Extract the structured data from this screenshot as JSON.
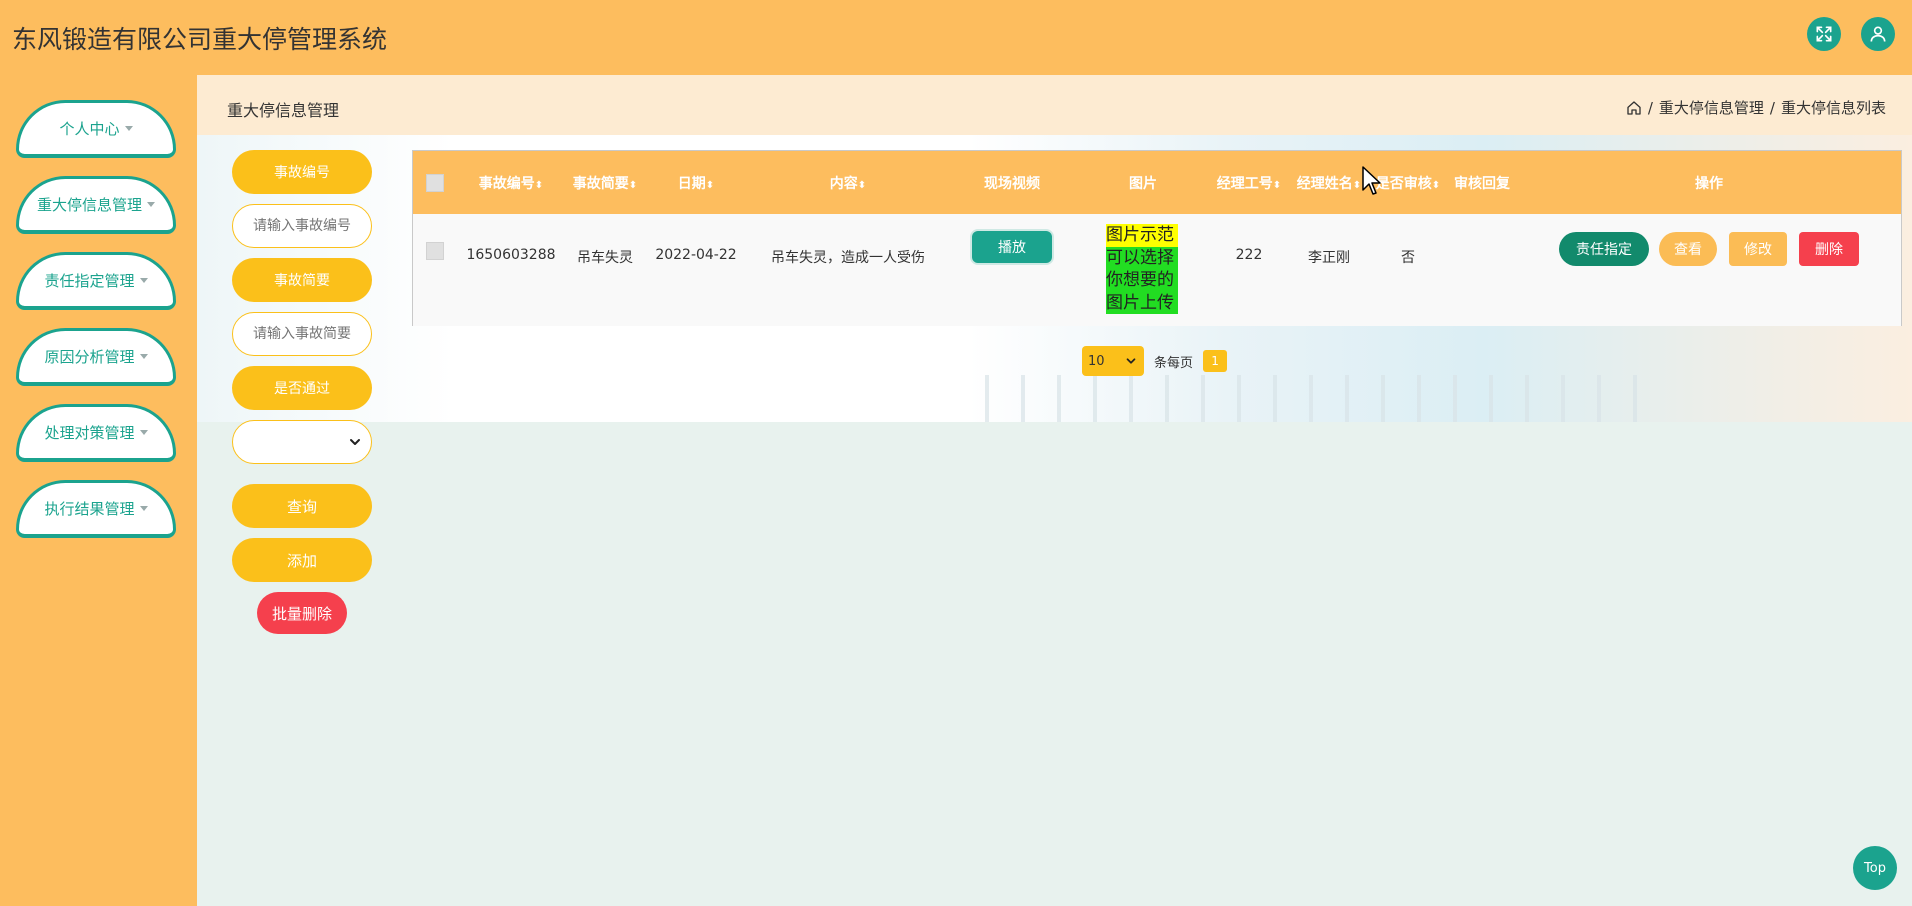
{
  "app": {
    "title": "东风锻造有限公司重大停管理系统"
  },
  "header": {
    "icons": [
      "fullscreen-icon",
      "user-icon"
    ]
  },
  "sidebar": {
    "items": [
      {
        "label": "个人中心"
      },
      {
        "label": "重大停信息管理"
      },
      {
        "label": "责任指定管理"
      },
      {
        "label": "原因分析管理"
      },
      {
        "label": "处理对策管理"
      },
      {
        "label": "执行结果管理"
      }
    ]
  },
  "page": {
    "title": "重大停信息管理",
    "breadcrumb": [
      "重大停信息管理",
      "重大停信息列表"
    ],
    "separator": "/"
  },
  "search": {
    "fields": [
      {
        "label": "事故编号",
        "placeholder": "请输入事故编号"
      },
      {
        "label": "事故简要",
        "placeholder": "请输入事故简要"
      }
    ],
    "pass_label": "是否通过",
    "pass_value": "",
    "query_button": "查询",
    "add_button": "添加",
    "batch_delete_button": "批量删除"
  },
  "table": {
    "columns": [
      "事故编号",
      "事故简要",
      "日期",
      "内容",
      "现场视频",
      "图片",
      "经理工号",
      "经理姓名",
      "是否审核",
      "审核回复",
      "操作"
    ],
    "sortable": [
      true,
      true,
      true,
      true,
      false,
      false,
      true,
      true,
      true,
      false,
      false
    ],
    "rows": [
      {
        "id": "1650603288",
        "brief": "吊车失灵",
        "date": "2022-04-22",
        "content": "吊车失灵，造成一人受伤",
        "video_button": "播放",
        "image_lines": [
          "图片示范",
          "可以选择",
          "你想要的",
          "图片上传"
        ],
        "manager_no": "222",
        "manager_name": "李正刚",
        "reviewed": "否",
        "review_reply": "",
        "actions": {
          "assign": "责任指定",
          "view": "查看",
          "edit": "修改",
          "delete": "删除"
        }
      }
    ]
  },
  "pagination": {
    "page_size": "10",
    "per_page_label": "条每页",
    "current_page": "1"
  },
  "top_button": "Top",
  "colors": {
    "header_bg": "#fdbd5e",
    "accent_green": "#1ba38e",
    "accent_yellow": "#fbc01a",
    "danger_red": "#f5404d"
  }
}
